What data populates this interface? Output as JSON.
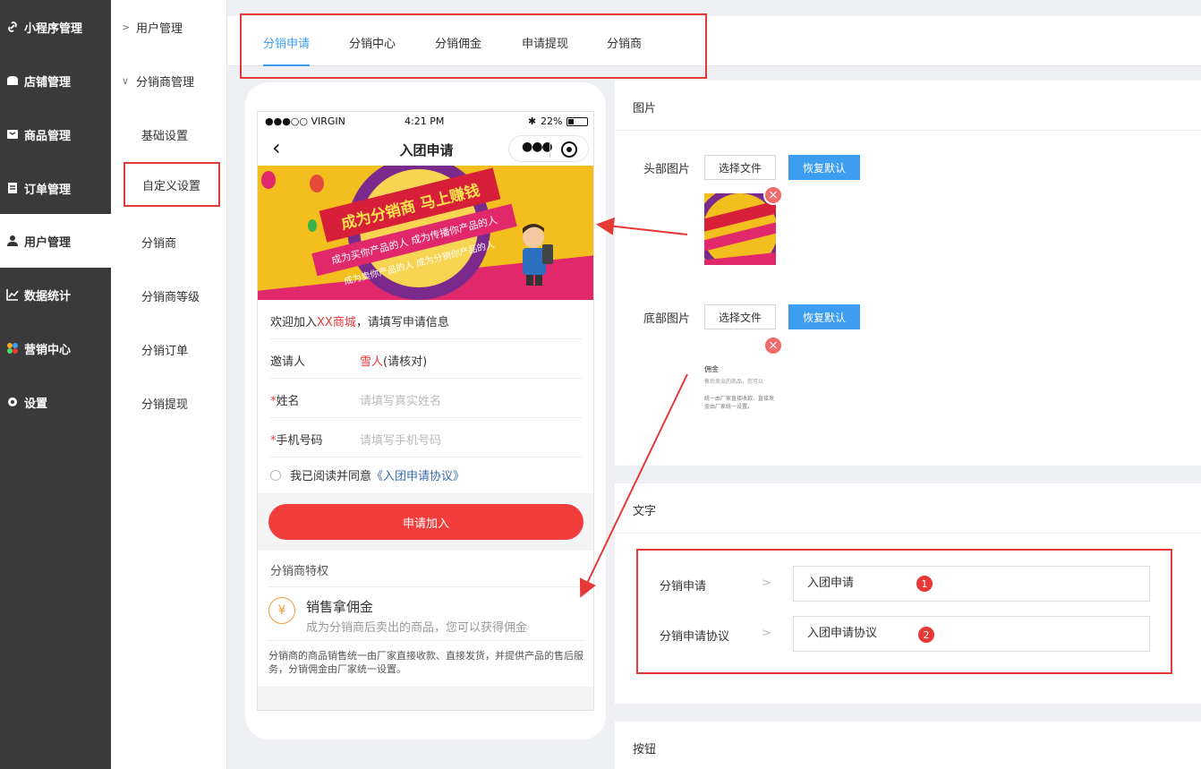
{
  "sidebar": {
    "items": [
      {
        "label": "小程序管理",
        "icon": "link-icon"
      },
      {
        "label": "店铺管理",
        "icon": "store-icon"
      },
      {
        "label": "商品管理",
        "icon": "box-icon"
      },
      {
        "label": "订单管理",
        "icon": "order-icon"
      },
      {
        "label": "用户管理",
        "icon": "user-icon",
        "active": true
      },
      {
        "label": "数据统计",
        "icon": "chart-icon"
      },
      {
        "label": "营销中心",
        "icon": "marketing-icon"
      },
      {
        "label": "设置",
        "icon": "gear-icon"
      }
    ]
  },
  "subnav": {
    "group_users": "用户管理",
    "group_distributor": "分销商管理",
    "items": [
      "基础设置",
      "自定义设置",
      "分销商",
      "分销商等级",
      "分销订单",
      "分销提现"
    ]
  },
  "tabs": [
    "分销申请",
    "分销中心",
    "分销佣金",
    "申请提现",
    "分销商"
  ],
  "phone": {
    "status": {
      "carrier": "●●●○○ VIRGIN",
      "time": "4:21 PM",
      "battery": "22%"
    },
    "title": "入团申请",
    "banner": {
      "headline": "成为分销商  马上赚钱",
      "line1": "成为买你产品的人 成为传播你产品的人",
      "line2": "成为卖你产品的人 成为分销你产品的人"
    },
    "welcome_prefix": "欢迎加入",
    "welcome_shop": "XX商城",
    "welcome_suffix": "，请填写申请信息",
    "inviter_label": "邀请人",
    "inviter_name": "雪人",
    "inviter_note": "(请核对)",
    "name_label": "姓名",
    "name_placeholder": "请填写真实姓名",
    "phone_label": "手机号码",
    "phone_placeholder": "请填写手机号码",
    "agree_text": "我已阅读并同意",
    "agree_link": "《入团申请协议》",
    "join_button": "申请加入",
    "privilege_title": "分销商特权",
    "privilege_item_title": "销售拿佣金",
    "privilege_item_desc": "成为分销商后卖出的商品，您可以获得佣金",
    "privilege_note": "分销商的商品销售统一由厂家直接收款、直接发货，并提供产品的售后服务，分销佣金由厂家统一设置。"
  },
  "image_panel": {
    "title": "图片",
    "header_label": "头部图片",
    "footer_label": "底部图片",
    "choose_file": "选择文件",
    "reset": "恢复默认",
    "footer_preview_title": "佣金",
    "footer_preview_line1": "售后卖出的商品，您可以",
    "footer_preview_line2": "统一由厂家直接收款、直接发",
    "footer_preview_line3": "金由厂家统一设置。"
  },
  "text_panel": {
    "title": "文字",
    "rows": [
      {
        "label": "分销申请",
        "value": "入团申请",
        "badge": "1"
      },
      {
        "label": "分销申请协议",
        "value": "入团申请协议",
        "badge": "2"
      }
    ]
  },
  "button_panel": {
    "title": "按钮"
  },
  "colors": {
    "accent": "#3d9df0",
    "highlight": "#e53935",
    "sidebar": "#3a3a3a",
    "join": "#f23d3d"
  }
}
